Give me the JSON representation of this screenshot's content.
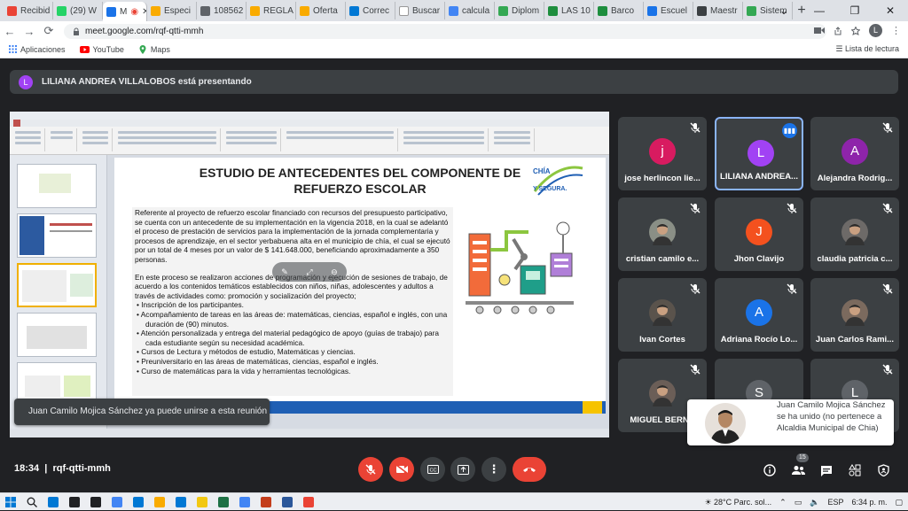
{
  "browser": {
    "tabs": [
      {
        "label": "Recibid",
        "color": "#ea4335"
      },
      {
        "label": "(29) W",
        "color": "#25d366"
      },
      {
        "label": "M",
        "color": "#1a73e8",
        "active": true
      },
      {
        "label": "Especi",
        "color": "#f9ab00"
      },
      {
        "label": "108562",
        "color": "#5f6368"
      },
      {
        "label": "REGLA",
        "color": "#f9ab00"
      },
      {
        "label": "Oferta",
        "color": "#f9ab00"
      },
      {
        "label": "Correc",
        "color": "#0078d4"
      },
      {
        "label": "Buscar",
        "color": "#ffffff"
      },
      {
        "label": "calcula",
        "color": "#4285f4"
      },
      {
        "label": "Diplom",
        "color": "#34a853"
      },
      {
        "label": "LAS 10",
        "color": "#1e8e3e"
      },
      {
        "label": "Barco",
        "color": "#1e8e3e"
      },
      {
        "label": "Escuel",
        "color": "#1a73e8"
      },
      {
        "label": "Maestr",
        "color": "#3c4043"
      },
      {
        "label": "Sistem",
        "color": "#34a853"
      }
    ],
    "new_tab": "+",
    "window_controls": {
      "down": "⌄",
      "minimize": "—",
      "restore": "❐",
      "close": "✕"
    },
    "nav": {
      "back": "←",
      "forward": "→",
      "reload": "⟳"
    },
    "url": "meet.google.com/rqf-qtti-mmh",
    "profile_initial": "L",
    "bookmarks": [
      {
        "label": "Aplicaciones",
        "icon": "grid-icon"
      },
      {
        "label": "YouTube",
        "icon": "youtube-icon"
      },
      {
        "label": "Maps",
        "icon": "maps-icon"
      }
    ],
    "reading_list": "Lista de lectura"
  },
  "meet": {
    "banner": {
      "initial": "L",
      "text": "LILIANA ANDREA VILLALOBOS está presentando"
    },
    "slide": {
      "title_line1": "ESTUDIO DE ANTECEDENTES DEL COMPONENTE DE",
      "title_line2": "REFUERZO ESCOLAR",
      "logo_text": "CHÍA EDUCADA, CULTURAL Y SEGURA",
      "paragraph1": "Referente al proyecto de refuerzo escolar financiado con recursos del presupuesto participativo, se cuenta con un antecedente de su implementación en la vigencia 2018, en la cual se adelantó el proceso de prestación de servicios para la implementación de la jornada complementaria y procesos de aprendizaje, en el sector yerbabuena alta en el municipio de chía, el cual se ejecutó por un total de 4 meses por un valor de $ 141.648.000, beneficiando aproximadamente a 350 personas.",
      "paragraph2": "En este proceso se realizaron acciones de programación y ejecución de sesiones de trabajo, de acuerdo a los contenidos temáticos establecidos con niños, niñas, adolescentes y adultos a través de actividades como: promoción y socialización del proyecto;",
      "bullets": [
        "Inscripción de los participantes.",
        "Acompañamiento de tareas en las áreas de: matemáticas, ciencias, español e inglés, con una duración de (90) minutos.",
        "Atención personalizada y entrega del material pedagógico de apoyo (guías de trabajo) para cada estudiante según su necesidad académica.",
        "Cursos de Lectura y métodos de estudio, Matemáticas y ciencias.",
        "Preuniversitario en las áreas de matemáticas, ciencias, español e inglés.",
        "Curso de matemáticas para la vida y herramientas tecnológicas."
      ]
    },
    "toast": "Juan Camilo Mojica Sánchez ya puede unirse a esta reunión",
    "participants": [
      {
        "name": "jose herlincon lie...",
        "initial": "j",
        "color": "#d81b60",
        "muted": true
      },
      {
        "name": "LILIANA ANDREA...",
        "initial": "L",
        "color": "#a142f4",
        "speaking": true
      },
      {
        "name": "Alejandra Rodrig...",
        "initial": "A",
        "color": "#8e24aa",
        "muted": true
      },
      {
        "name": "cristian camilo e...",
        "initial": "",
        "color": "#8a8f86",
        "muted": true,
        "photo": true
      },
      {
        "name": "Jhon Clavijo",
        "initial": "J",
        "color": "#f4511e",
        "muted": true
      },
      {
        "name": "claudia patricia c...",
        "initial": "",
        "color": "#6d6a68",
        "muted": true,
        "photo": true
      },
      {
        "name": "Ivan Cortes",
        "initial": "",
        "color": "#5a534c",
        "muted": true,
        "photo": true
      },
      {
        "name": "Adriana Rocío Lo...",
        "initial": "A",
        "color": "#1a73e8",
        "muted": true
      },
      {
        "name": "Juan Carlos Rami...",
        "initial": "",
        "color": "#7b6a5e",
        "muted": true,
        "photo": true
      },
      {
        "name": "MIGUEL BERNA",
        "initial": "",
        "color": "#6b5e57",
        "muted": true,
        "photo": true
      },
      {
        "name": "",
        "initial": "S",
        "color": "#5f6368",
        "muted": false,
        "photo": false
      },
      {
        "name": "",
        "initial": "L",
        "color": "#5f6368",
        "muted": true
      }
    ],
    "join_popup": "Juan Camilo Mojica Sánchez se ha unido (no pertenece a Alcaldia Municipal de Chia)",
    "time": "18:34",
    "meeting_code": "rqf-qtti-mmh",
    "people_count": "15"
  },
  "taskbar": {
    "apps": [
      "#0078d4",
      "#202124",
      "#202124",
      "#4285f4",
      "#0078d4",
      "#f9ab00",
      "#0078d4",
      "#f2c811",
      "#1e7145",
      "#4285f4",
      "#c43e1c",
      "#2b579a",
      "#ea4335"
    ],
    "weather": "28°C  Parc. sol...",
    "lang": "ESP",
    "clock": "6:34 p. m."
  }
}
